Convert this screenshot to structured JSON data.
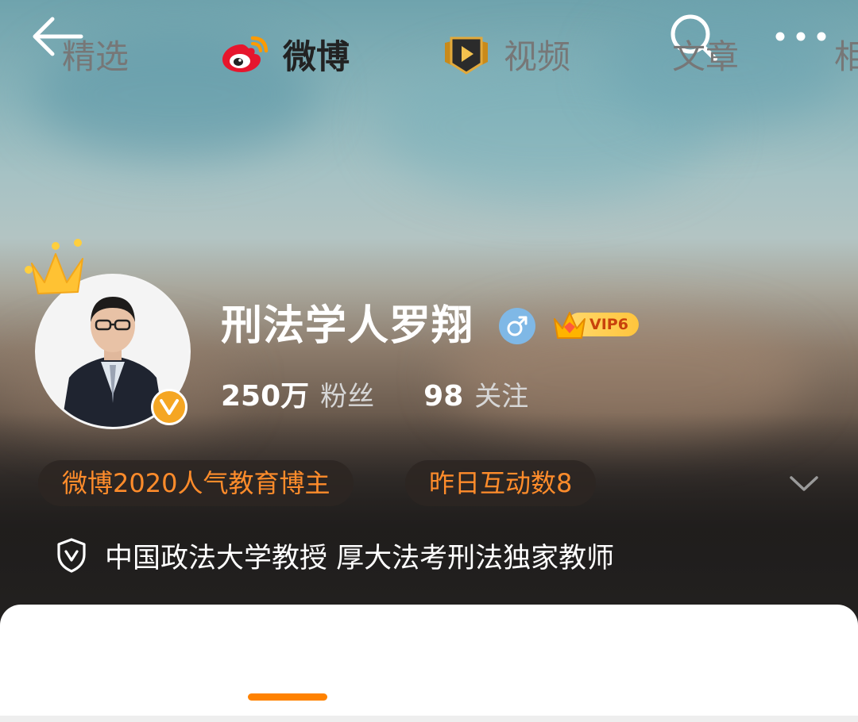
{
  "topbar": {
    "back_icon": "arrow-left-icon",
    "search_icon": "search-icon",
    "more_icon": "more-dots-icon"
  },
  "profile": {
    "username": "刑法学人罗翔",
    "gender": "male",
    "vip_label": "VIP6",
    "stats": {
      "followers_count": "250万",
      "followers_label": "粉丝",
      "following_count": "98",
      "following_label": "关注"
    },
    "tags": [
      "微博2020人气教育博主",
      "昨日互动数8"
    ],
    "bio": "中国政法大学教授 厚大法考刑法独家教师"
  },
  "tabs": [
    {
      "label": "精选",
      "active": false
    },
    {
      "label": "微博",
      "active": true,
      "icon": "weibo-logo-icon"
    },
    {
      "label": "视频",
      "active": false,
      "icon": "video-play-icon"
    },
    {
      "label": "文章",
      "active": false
    },
    {
      "label": "相",
      "active": false
    }
  ],
  "colors": {
    "accent": "#ff8200",
    "tag_text": "#ff8c2b",
    "verify_badge": "#f5a623",
    "gender_badge": "#7fb8e6"
  }
}
